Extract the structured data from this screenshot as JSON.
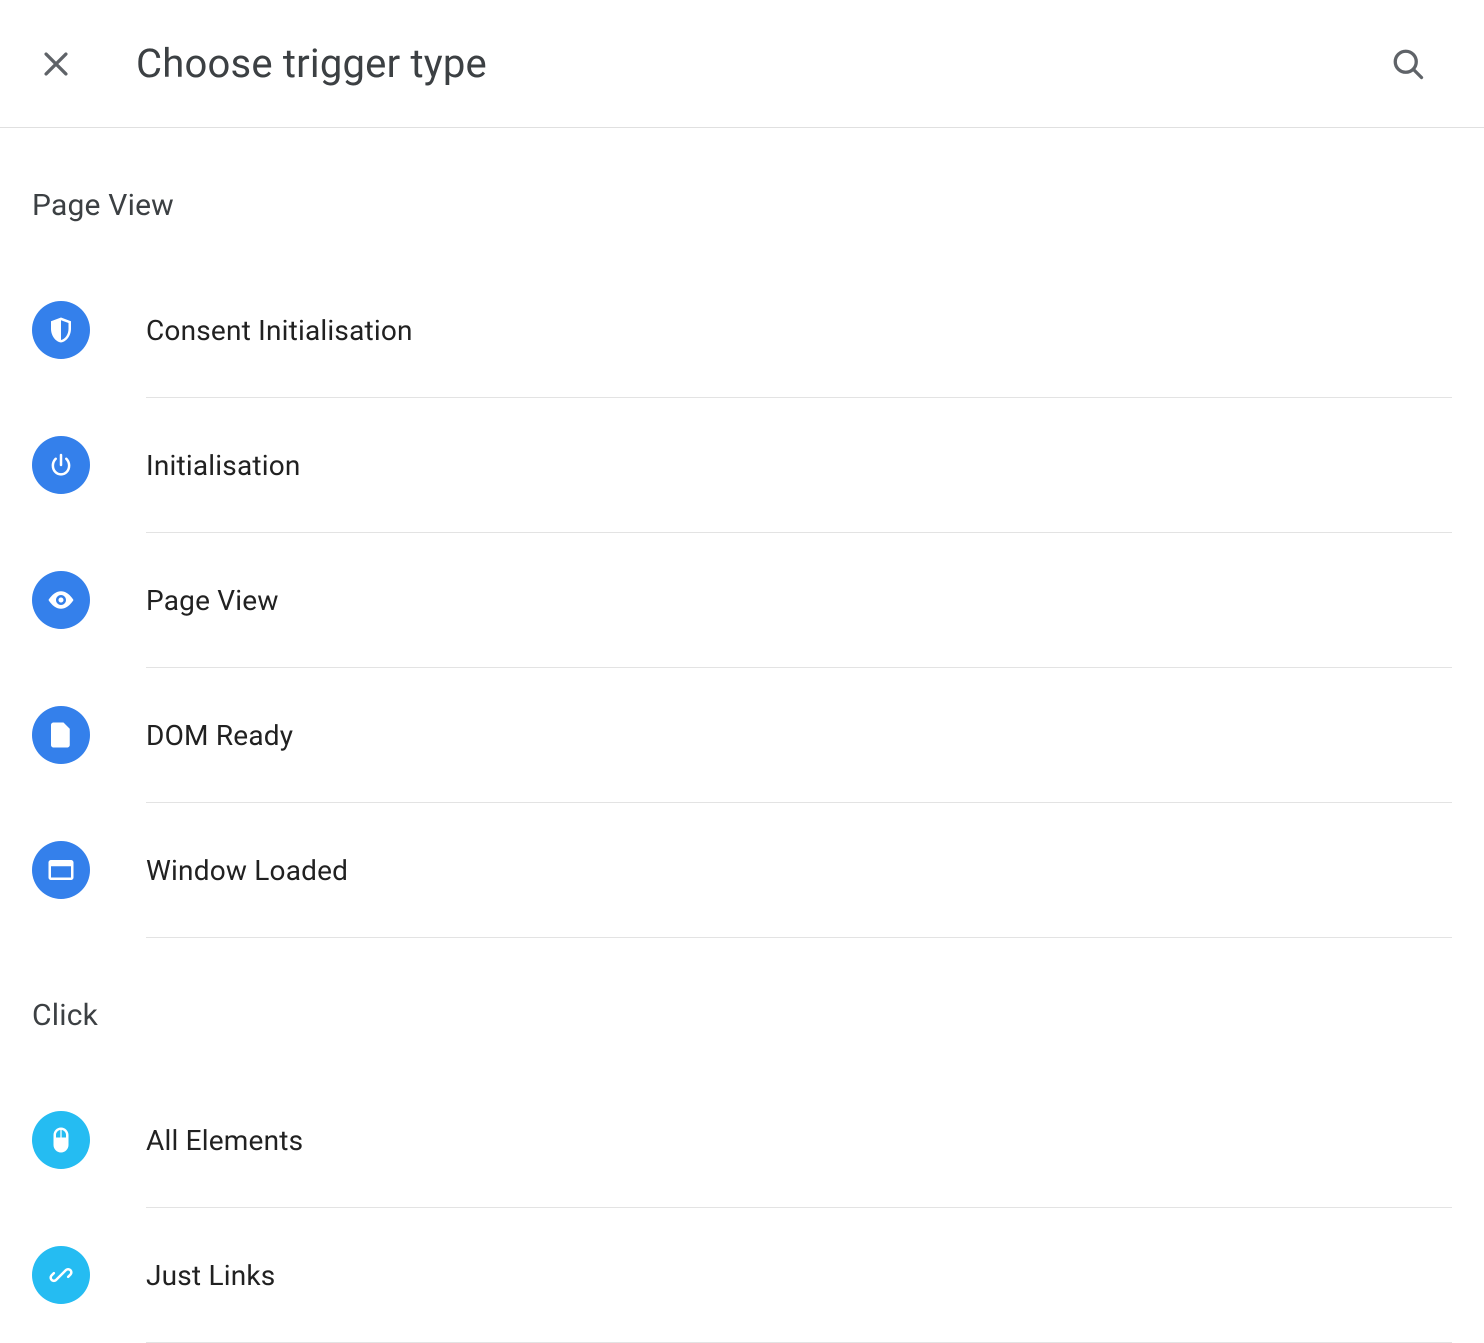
{
  "header": {
    "title": "Choose trigger type"
  },
  "sections": [
    {
      "heading": "Page View",
      "items": [
        {
          "icon": "shield",
          "color": "blue",
          "label": "Consent Initialisation"
        },
        {
          "icon": "power",
          "color": "blue",
          "label": "Initialisation"
        },
        {
          "icon": "eye",
          "color": "blue",
          "label": "Page View"
        },
        {
          "icon": "document",
          "color": "blue",
          "label": "DOM Ready"
        },
        {
          "icon": "window",
          "color": "blue",
          "label": "Window Loaded"
        }
      ]
    },
    {
      "heading": "Click",
      "items": [
        {
          "icon": "mouse",
          "color": "cyan",
          "label": "All Elements"
        },
        {
          "icon": "link",
          "color": "cyan",
          "label": "Just Links"
        }
      ]
    }
  ]
}
